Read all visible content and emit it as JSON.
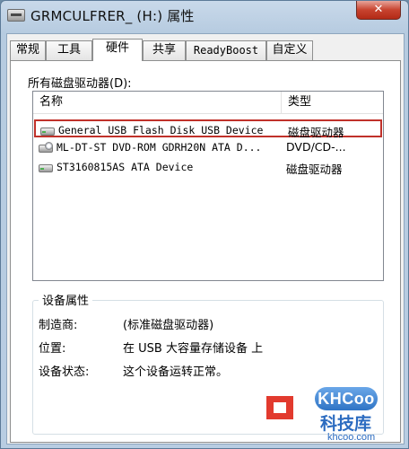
{
  "window": {
    "title": "GRMCULFRER_ (H:) 属性",
    "close_glyph": "✕"
  },
  "tabs": [
    {
      "label": "常规",
      "active": false
    },
    {
      "label": "工具",
      "active": false
    },
    {
      "label": "硬件",
      "active": true
    },
    {
      "label": "共享",
      "active": false
    },
    {
      "label": "ReadyBoost",
      "active": false
    },
    {
      "label": "自定义",
      "active": false
    }
  ],
  "hardware": {
    "section_label": "所有磁盘驱动器(D):",
    "columns": {
      "name": "名称",
      "type": "类型"
    },
    "devices": [
      {
        "name": "General USB Flash Disk USB Device",
        "type": "磁盘驱动器",
        "icon": "usb-drive-icon",
        "selected": true
      },
      {
        "name": "ML-DT-ST DVD-ROM GDRH20N ATA D...",
        "type": "DVD/CD-...",
        "icon": "dvd-drive-icon",
        "selected": false
      },
      {
        "name": "ST3160815AS ATA Device",
        "type": "磁盘驱动器",
        "icon": "hard-disk-icon",
        "selected": false
      }
    ]
  },
  "properties": {
    "title": "设备属性",
    "manufacturer_label": "制造商:",
    "manufacturer_value": "(标准磁盘驱动器)",
    "location_label": "位置:",
    "location_value": "在 USB 大容量存储设备 上",
    "status_label": "设备状态:",
    "status_value": "这个设备运转正常。"
  },
  "watermark": {
    "logo": "KHCoo",
    "name": "科技库",
    "url": "khcoo.com"
  }
}
